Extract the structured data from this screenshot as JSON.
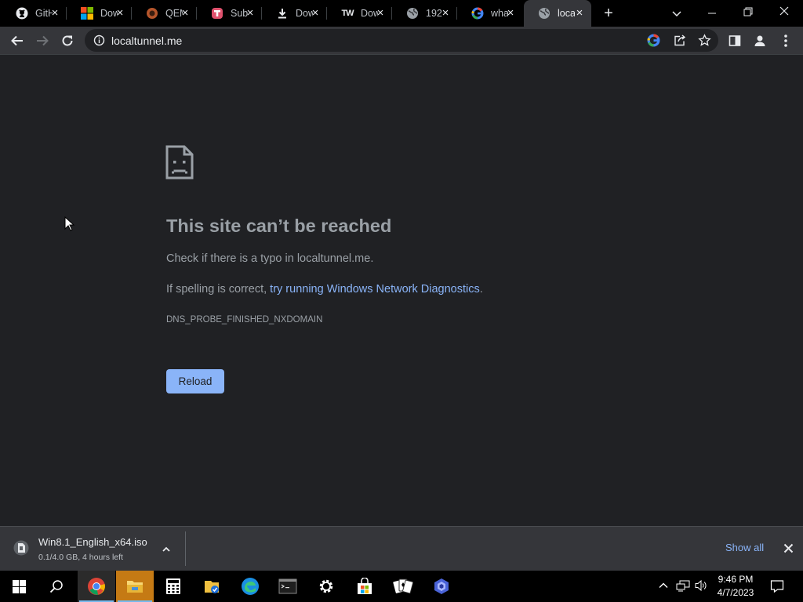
{
  "tabs": [
    {
      "title": "GitHub",
      "icon": "github-icon"
    },
    {
      "title": "Download",
      "icon": "microsoft-icon"
    },
    {
      "title": "QEMU",
      "icon": "qemu-icon"
    },
    {
      "title": "Sub",
      "icon": "subtitle-icon"
    },
    {
      "title": "Download",
      "icon": "download-icon"
    },
    {
      "title": "Download",
      "icon": "tw-icon"
    },
    {
      "title": "192",
      "icon": "globe-icon"
    },
    {
      "title": "what",
      "icon": "google-icon"
    },
    {
      "title": "localtunnel.me",
      "icon": "globe-icon"
    }
  ],
  "tw_logo": "TW",
  "address": {
    "url": "localtunnel.me"
  },
  "error": {
    "title": "This site can’t be reached",
    "line1": "Check if there is a typo in localtunnel.me.",
    "line2_prefix": "If spelling is correct, ",
    "line2_link": "try running Windows Network Diagnostics",
    "line2_suffix": ".",
    "code": "DNS_PROBE_FINISHED_NXDOMAIN",
    "reload_label": "Reload"
  },
  "download": {
    "filename": "Win8.1_English_x64.iso",
    "status": "0.1/4.0 GB, 4 hours left",
    "show_all": "Show all"
  },
  "taskbar": {
    "time": "9:46 PM",
    "date": "4/7/2023",
    "apps": [
      "start",
      "search",
      "chrome",
      "file-explorer",
      "calculator",
      "files",
      "edge",
      "terminal",
      "settings",
      "store",
      "solitaire",
      "app"
    ]
  },
  "colors": {
    "link": "#8ab4f8",
    "background": "#202124",
    "toolbar": "#35363a"
  }
}
